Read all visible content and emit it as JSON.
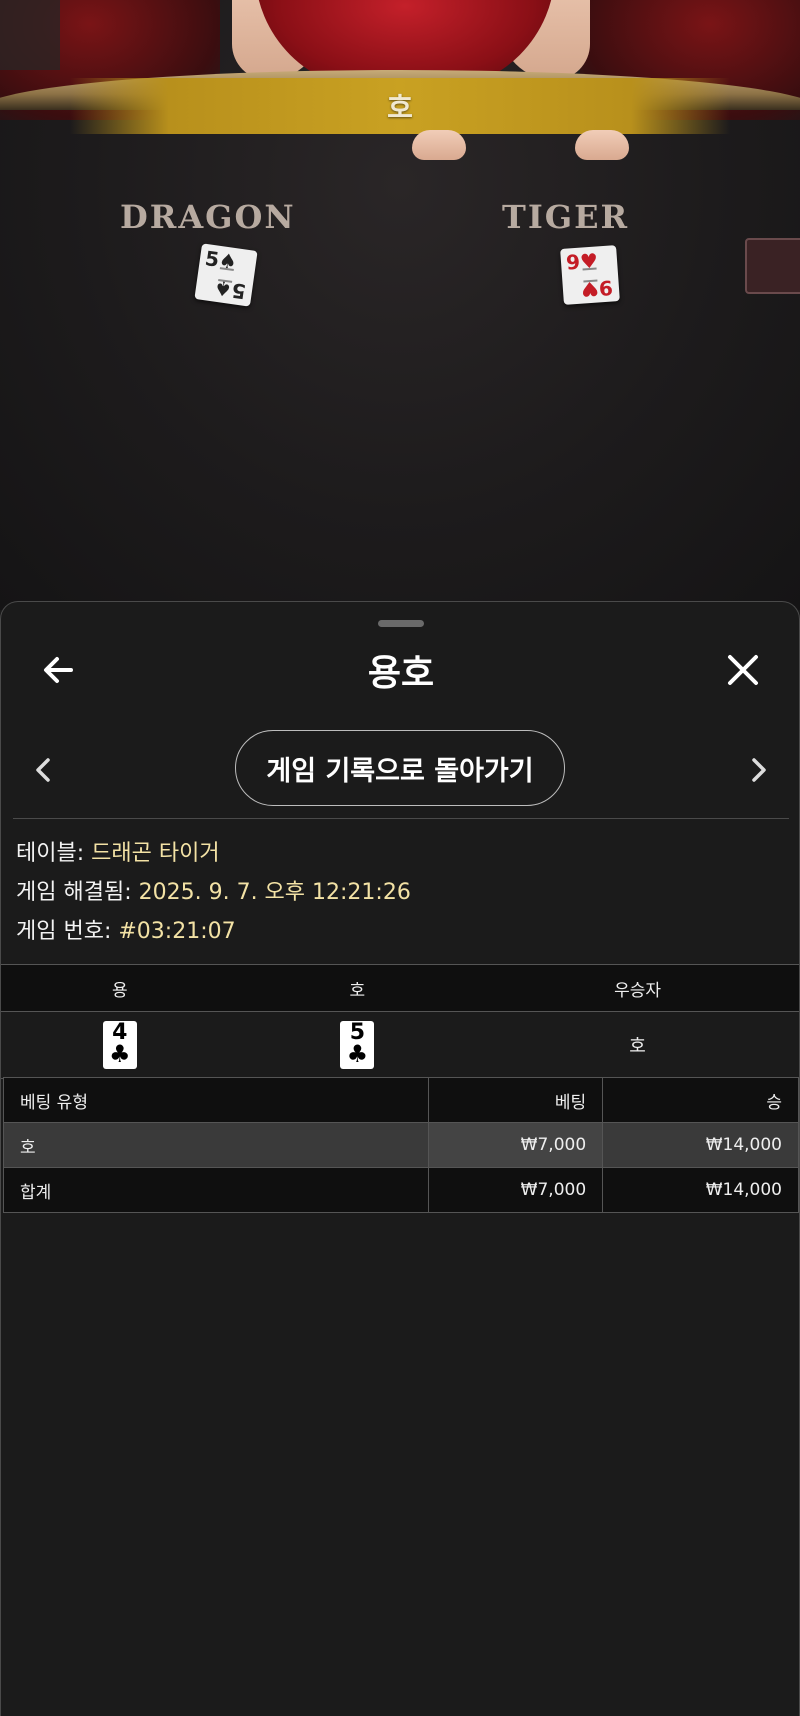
{
  "video": {
    "banner_result": "호",
    "felt_left_label": "DRAGON",
    "felt_right_label": "TIGER",
    "dragon_card": {
      "rank": "5",
      "suit": "♠"
    },
    "tiger_card": {
      "rank": "9",
      "suit": "♥"
    }
  },
  "sheet": {
    "title": "용호",
    "history_button": "게임 기록으로 돌아가기",
    "info": {
      "table_label": "테이블:",
      "table_value": "드래곤 타이거",
      "resolved_label": "게임 해결됨:",
      "resolved_value": "2025. 9. 7. 오후 12:21:26",
      "game_no_label": "게임 번호:",
      "game_no_value": "#03:21:07"
    },
    "result_table": {
      "headers": [
        "용",
        "호",
        "우승자"
      ],
      "dragon_card": {
        "rank": "4",
        "suit": "♣"
      },
      "tiger_card": {
        "rank": "5",
        "suit": "♣"
      },
      "winner": "호"
    },
    "bets_table": {
      "headers": [
        "베팅 유형",
        "베팅",
        "승"
      ],
      "rows": [
        {
          "type": "호",
          "bet": "₩7,000",
          "win": "₩14,000"
        },
        {
          "type": "합계",
          "bet": "₩7,000",
          "win": "₩14,000"
        }
      ]
    }
  },
  "colors": {
    "accent_gold": "#c9a122",
    "info_value": "#f3e2a5",
    "sheet_bg": "#1b1b1b"
  }
}
